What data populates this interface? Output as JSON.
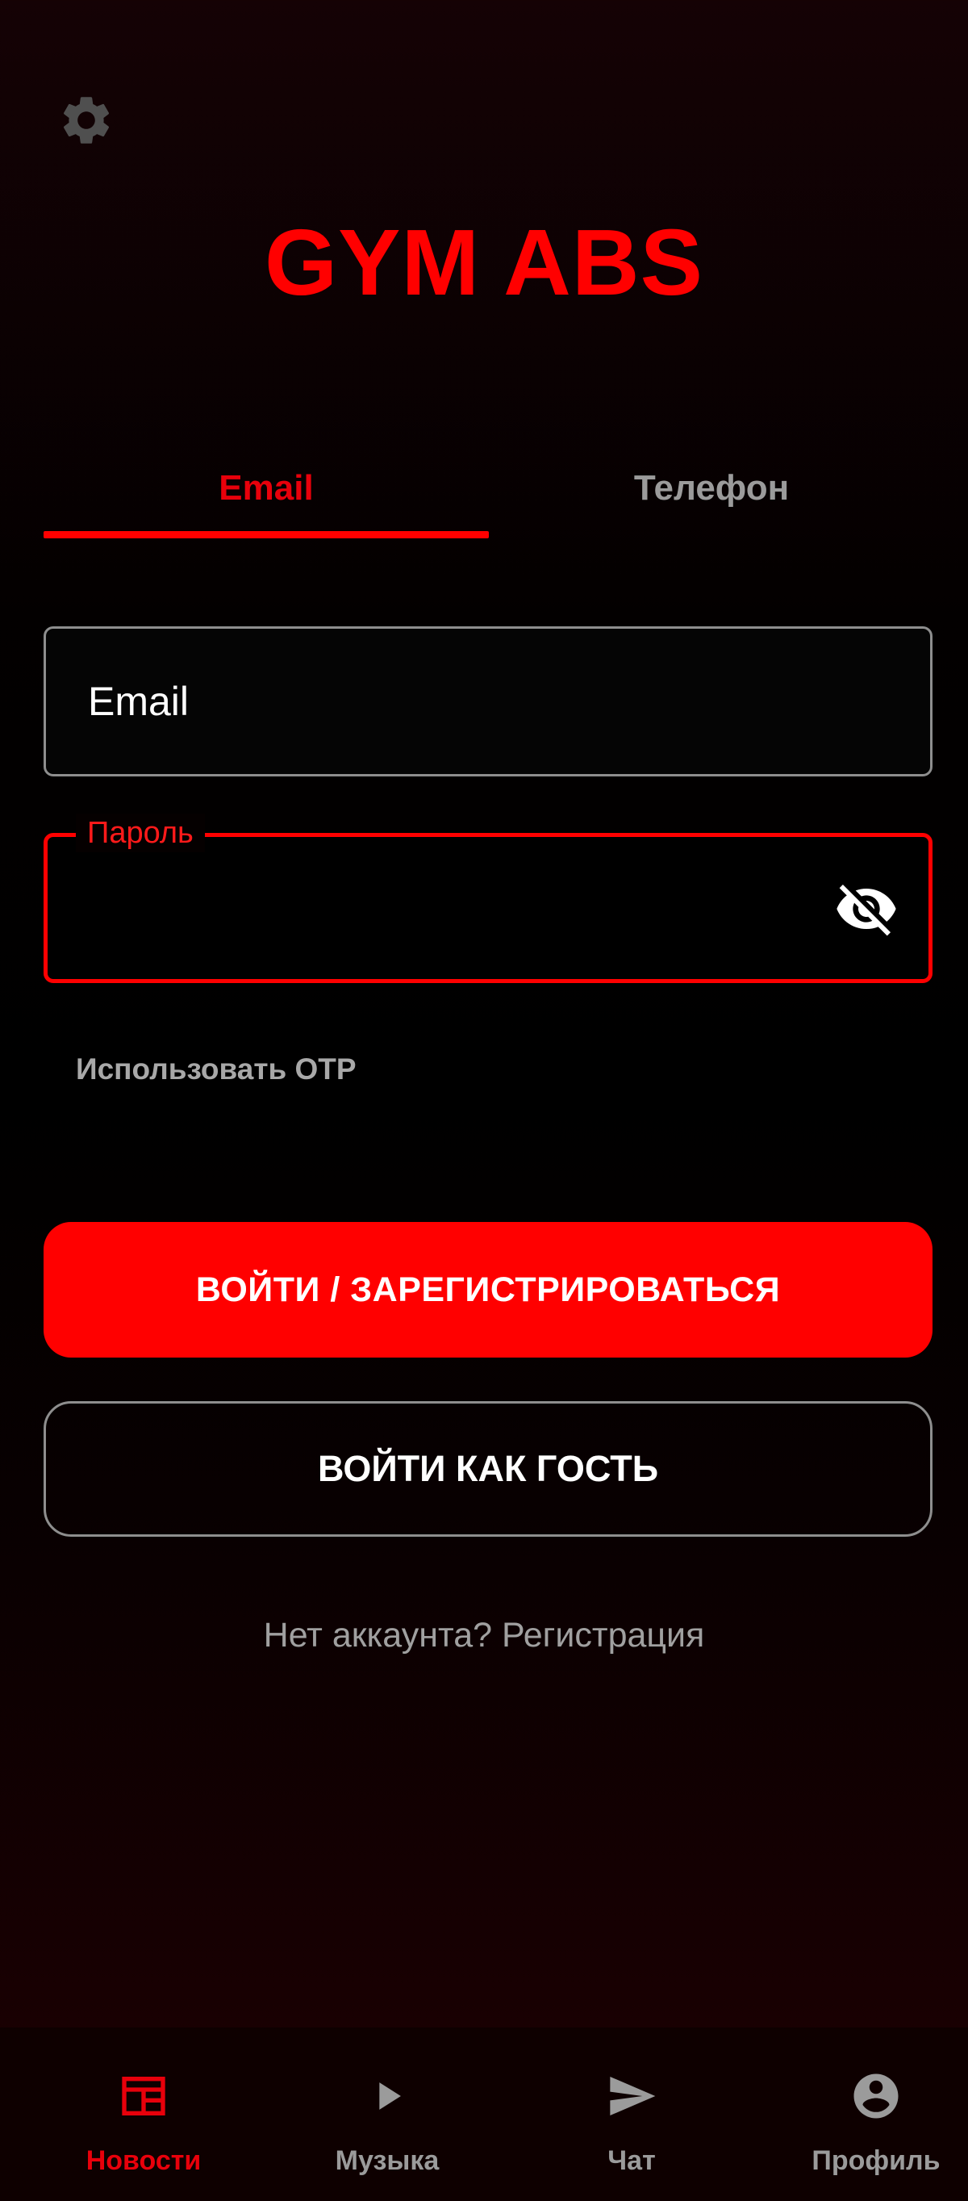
{
  "app": {
    "title": "GYM ABS"
  },
  "tabs": [
    {
      "label": "Email",
      "active": true
    },
    {
      "label": "Телефон",
      "active": false
    }
  ],
  "form": {
    "email_placeholder": "Email",
    "email_value": "",
    "password_label": "Пароль",
    "password_value": "",
    "otp_label": "Использовать OTP"
  },
  "buttons": {
    "login_register": "ВОЙТИ / ЗАРЕГИСТРИРОВАТЬСЯ",
    "guest": "ВОЙТИ КАК ГОСТЬ"
  },
  "register_link": "Нет аккаунта? Регистрация",
  "bottom_nav": [
    {
      "label": "Новости",
      "icon": "news-icon",
      "active": true
    },
    {
      "label": "Музыка",
      "icon": "play-icon",
      "active": false
    },
    {
      "label": "Чат",
      "icon": "send-icon",
      "active": false
    },
    {
      "label": "Профиль",
      "icon": "account-circle-icon",
      "active": false
    }
  ],
  "icons": {
    "settings": "gear-icon",
    "password_toggle": "eye-off-icon"
  },
  "colors": {
    "accent": "#ff0000",
    "inactive": "#9b9b9b",
    "background": "#000000"
  }
}
